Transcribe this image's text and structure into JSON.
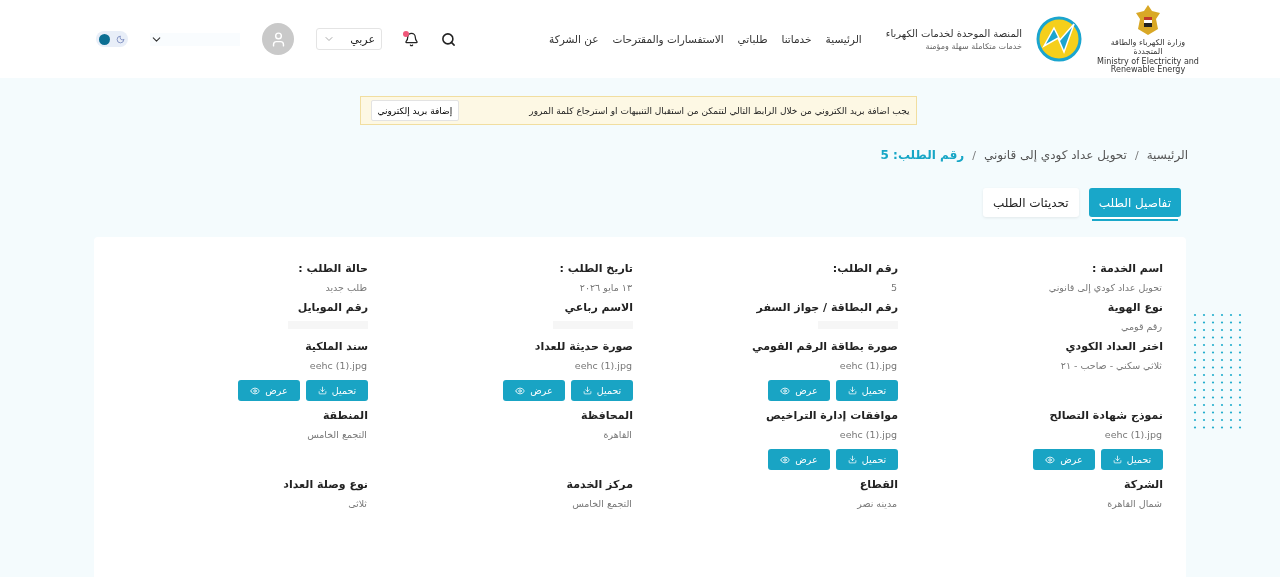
{
  "header": {
    "ministry_text": "وزارة الكهرباء والطاقة المتجددة",
    "ministry_text_en": "Ministry of Electricity and Renewable Energy",
    "title": "المنصة الموحدة لخدمات الكهرباء",
    "subtitle": "خدمات متكاملة سهلة ومؤمنة",
    "nav": [
      {
        "label": "الرئيسية"
      },
      {
        "label": "خدماتنا"
      },
      {
        "label": "طلباتي"
      },
      {
        "label": "الاستفسارات والمقترحات"
      },
      {
        "label": "عن الشركة"
      }
    ],
    "notifications_unread": true,
    "language": "عربي",
    "dark_mode": false
  },
  "alert": {
    "message": "يجب اضافة بريد الكتروني من خلال الرابط التالي لتتمكن من استقبال التنبيهات او استرجاع كلمة المرور",
    "button": "إضافة بريد إلكتروني"
  },
  "breadcrumb": [
    {
      "label": "الرئيسية",
      "separator": "/"
    },
    {
      "label": "تحويل عداد كودي إلى قانوني",
      "separator": "/"
    }
  ],
  "breadcrumb_current": "رقم الطلب: 5",
  "tabs": [
    {
      "label": "تفاصيل الطلب",
      "selected": true
    },
    {
      "label": "تحديثات الطلب",
      "selected": false
    }
  ],
  "fields": [
    {
      "label": "اسم الخدمة :",
      "value": "تحويل عداد كودي إلى قانوني",
      "kind": "text"
    },
    {
      "label": "رقم الطلب:",
      "value": "5",
      "kind": "text"
    },
    {
      "label": "تاريخ الطلب :",
      "value": "١٣ مايو ٢٠٢٦",
      "kind": "text"
    },
    {
      "label": "حالة الطلب :",
      "value": "طلب جديد",
      "kind": "text"
    },
    {
      "label": "نوع الهوية",
      "value": "رقم قومي",
      "kind": "text"
    },
    {
      "label": "رقم البطاقة / جواز السفر",
      "kind": "hidden"
    },
    {
      "label": "الاسم رباعي",
      "kind": "hidden"
    },
    {
      "label": "رقم الموبايل",
      "kind": "hidden"
    },
    {
      "label": "اختر العداد الكودي",
      "value": "ثلاثي سكني - صاحب - ٢١",
      "kind": "text"
    },
    {
      "label": "صورة بطاقة الرقم القومي",
      "value": "eehc (1).jpg",
      "kind": "file",
      "download": "تحميل",
      "view": "عرض"
    },
    {
      "label": "صورة حديثة للعداد",
      "value": "eehc (1).jpg",
      "kind": "file",
      "download": "تحميل",
      "view": "عرض"
    },
    {
      "label": "سند الملكية",
      "value": "eehc (1).jpg",
      "kind": "file",
      "download": "تحميل",
      "view": "عرض"
    },
    {
      "label": "نموذج شهادة التصالح",
      "value": "eehc (1).jpg",
      "kind": "file",
      "download": "تحميل",
      "view": "عرض"
    },
    {
      "label": "موافقات إدارة التراخيص",
      "value": "eehc (1).jpg",
      "kind": "file",
      "download": "تحميل",
      "view": "عرض"
    },
    {
      "label": "المحافظة",
      "value": "القاهرة",
      "kind": "text"
    },
    {
      "label": "المنطقة",
      "value": "التجمع الخامس",
      "kind": "text"
    },
    {
      "label": "الشركة",
      "value": "شمال القاهرة",
      "kind": "text"
    },
    {
      "label": "القطاع",
      "value": "مدينه نصر",
      "kind": "text"
    },
    {
      "label": "مركز الخدمة",
      "value": "التجمع الخامس",
      "kind": "text"
    },
    {
      "label": "نوع وصلة العداد",
      "value": "ثلاثى",
      "kind": "text"
    }
  ]
}
